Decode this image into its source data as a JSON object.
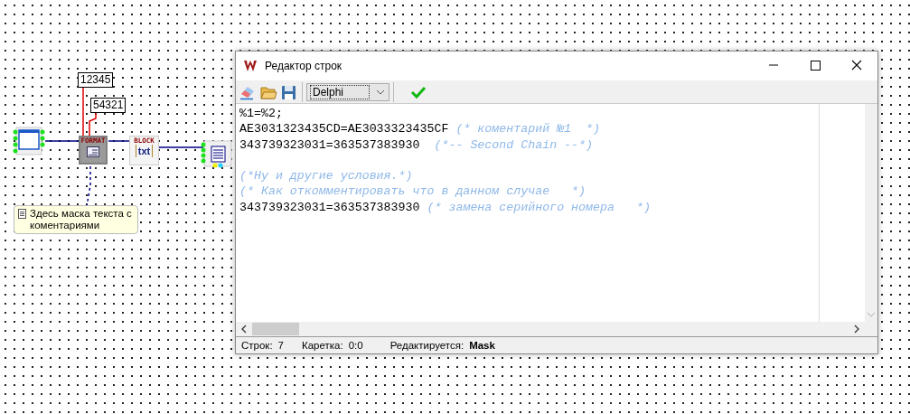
{
  "diagram": {
    "labels": [
      {
        "text": "12345"
      },
      {
        "text": "54321"
      }
    ],
    "format_node": {
      "caption": "FORMAT"
    },
    "block_node": {
      "caption": "BLOCK",
      "content": "txt"
    },
    "note": {
      "text": "Здесь маска текста с коментариями"
    }
  },
  "window": {
    "title": "Редактор строк",
    "toolbar": {
      "syntax": "Delphi"
    },
    "lines": [
      {
        "kind": "text",
        "code": "%1=%2;"
      },
      {
        "kind": "text",
        "code": "AE3031323435CD=AE3033323435CF",
        "comment": "(* коментарий №1  *)"
      },
      {
        "kind": "text",
        "code": "343739323031=363537383930",
        "comment": " (*-- Second Chain --*)"
      },
      {
        "kind": "blank"
      },
      {
        "kind": "text",
        "comment": "(*Ну и другие условия.*)"
      },
      {
        "kind": "text",
        "comment": "(* Как откомментировать что в данном случае   *)"
      },
      {
        "kind": "text",
        "code": "343739323031=363537383930",
        "comment": "(* замена серийного номера   *)"
      }
    ],
    "status_bar": [
      {
        "label": "Строк:",
        "value": "7",
        "bold": false
      },
      {
        "label": "Каретка:",
        "value": "0:0",
        "bold": false
      },
      {
        "label": "Редактируется:",
        "value": "Mask",
        "bold": true
      }
    ]
  }
}
